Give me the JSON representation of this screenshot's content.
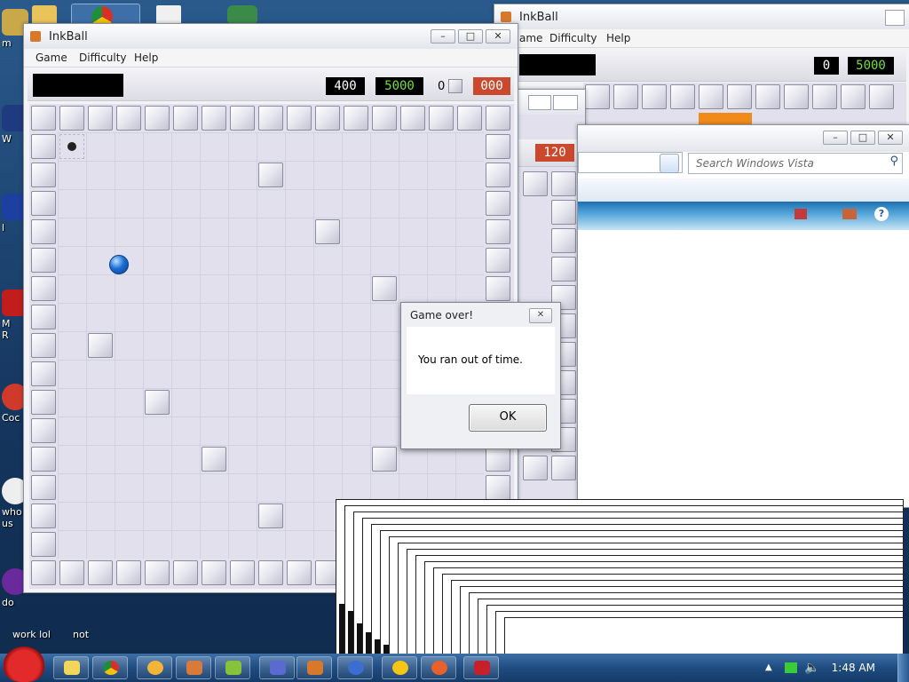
{
  "desktop": {
    "icons": [
      {
        "label": "m",
        "color": "#c9a84a"
      },
      {
        "label": "W",
        "color": "#203a80"
      },
      {
        "label": "l",
        "color": "#1d3fa0"
      },
      {
        "label": "M\nR",
        "color": "#c21d1d"
      },
      {
        "label": "Coc",
        "color": "#d03a2a"
      },
      {
        "label": "who\nus",
        "color": "#eeeeee"
      },
      {
        "label": "do",
        "color": "#6a2a9c"
      }
    ],
    "bottom_labels": [
      "work lol",
      "not"
    ]
  },
  "main_window": {
    "title": "InkBall",
    "menu": [
      "Game",
      "Difficulty",
      "Help"
    ],
    "score": "400",
    "target": "5000",
    "ball_count": "0",
    "timer": "000"
  },
  "back_window_right": {
    "title": "InkBall",
    "menu_partial": [
      "ame",
      "Difficulty",
      "Help"
    ],
    "score": "0",
    "target": "5000"
  },
  "back_window_mid": {
    "timer": "120"
  },
  "browser_window": {
    "search_placeholder": "Search Windows Vista"
  },
  "dialog": {
    "title": "Game over!",
    "message": "You ran out of time.",
    "ok_label": "OK",
    "close_glyph": "✕"
  },
  "taskbar": {
    "clock": "1:48 AM"
  },
  "colors": {
    "lcd_white": "#ffffff",
    "lcd_green": "#6fe03c",
    "lcd_red_bg": "#c9482e",
    "ball_blue": "#1a6fd4"
  }
}
